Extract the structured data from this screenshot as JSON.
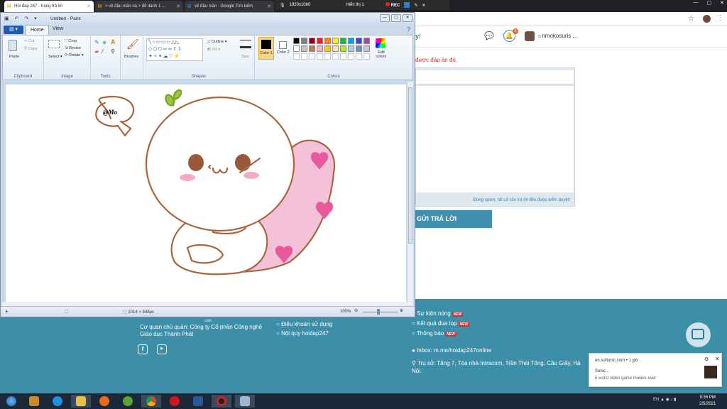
{
  "browser": {
    "tabs": [
      {
        "label": "Hỏi đáp 247 - trang trả lời",
        "active": true
      },
      {
        "label": "> về đâu mãn nà > để dành 1 ..."
      },
      {
        "label": "vẽ đâu mãn - Google Tìm kiếm"
      }
    ],
    "recorder": {
      "resolution": "1920x1080",
      "display": "Hiển thị 1",
      "rec": "REC"
    }
  },
  "site": {
    "brand_tail": "y!",
    "notification_count": "6",
    "user_name": "☼nmokosuris ...",
    "message": "được đáp án đó.",
    "editor_note": "Đừng spam, tất cả câu trả lời đều được kiểm duyệt!",
    "submit_label": "GỬI TRẢ LỜI"
  },
  "footer": {
    "org_line": "Cơ quan chủ quản: Công ty Cổ phần Công nghệ",
    "org_line2": "Giáo dục Thành Phát",
    "links_mid": [
      "Điều khoản sử dụng",
      "Nội quy hoidap247"
    ],
    "links_right": [
      "Sự kiện nóng",
      "Kết quả đua top",
      "Thông báo"
    ],
    "new_badge": "NEW",
    "inbox": "Inbox: m.me/hoidap247online",
    "address": "Trụ sở: Tầng 7, Tòa nhà Intracom, Trần Thái Tông, Cầu Giấy, Hà",
    "address2": "Nội.",
    "com": ".com"
  },
  "notification": {
    "source": "en.softonic.com • 1 giờ",
    "title": "Sonic...",
    "body": "5 worst video game movies ever"
  },
  "taskbar": {
    "time": "9:36 PM",
    "date": "2/5/2021",
    "lang": "EN"
  },
  "paint": {
    "title": "Untitled - Paint",
    "tabs": {
      "home": "Home",
      "view": "View"
    },
    "groups": {
      "clipboard": "Clipboard",
      "image": "Image",
      "tools": "Tools",
      "shapes": "Shapes",
      "colors": "Colors"
    },
    "buttons": {
      "paste": "Paste",
      "cut": "Cut",
      "copy": "Copy",
      "select": "Select",
      "crop": "Crop",
      "resize": "Resize",
      "rotate": "Rotate",
      "brushes": "Brushes",
      "outline": "Outline",
      "fill": "Fill",
      "size": "Size",
      "color1": "Color 1",
      "color2": "Color 2",
      "edit_colors": "Edit colors"
    },
    "canvas_text": "@Mo",
    "status": {
      "dimensions": "1014 × 848px",
      "zoom": "100%"
    },
    "palette": [
      "#000000",
      "#7f7f7f",
      "#880015",
      "#ed1c24",
      "#ff7f27",
      "#fff200",
      "#22b14c",
      "#00a2e8",
      "#3f48cc",
      "#a349a4",
      "#ffffff",
      "#c3c3c3",
      "#b97a57",
      "#ffaec9",
      "#ffc90e",
      "#efe4b0",
      "#b5e61d",
      "#99d9ea",
      "#7092be",
      "#c8bfe7"
    ],
    "drawing_colors": {
      "outline": "#a8663f",
      "pink": "#f4c2d8",
      "heart": "#e85a9c",
      "sprout": "#9ac83a"
    }
  }
}
